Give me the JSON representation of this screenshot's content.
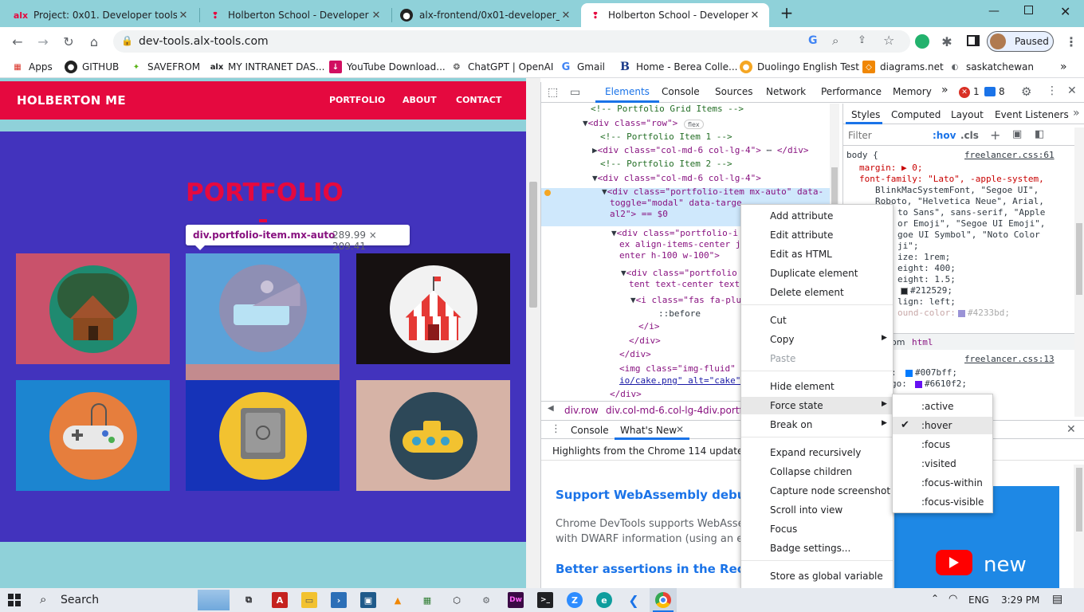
{
  "browser": {
    "tabs": [
      {
        "label": "Project: 0x01. Developer tools | L",
        "icon": "alx-icon"
      },
      {
        "label": "Holberton School - Developer to",
        "icon": "holberton-icon"
      },
      {
        "label": "alx-frontend/0x01-developer_to",
        "icon": "github-icon"
      },
      {
        "label": "Holberton School - Developer to",
        "icon": "holberton-icon"
      }
    ],
    "url": "dev-tools.alx-tools.com",
    "profile_status": "Paused",
    "bookmarks": [
      {
        "label": "Apps"
      },
      {
        "label": "GITHUB"
      },
      {
        "label": "SAVEFROM"
      },
      {
        "label": "MY INTRANET DAS..."
      },
      {
        "label": "YouTube Download..."
      },
      {
        "label": "ChatGPT | OpenAI"
      },
      {
        "label": "Gmail"
      },
      {
        "label": "Home - Berea Colle..."
      },
      {
        "label": "Duolingo English Test"
      },
      {
        "label": "diagrams.net"
      },
      {
        "label": "saskatchewan"
      }
    ]
  },
  "site": {
    "brand": "HOLBERTON ME",
    "nav": [
      "PORTFOLIO",
      "ABOUT",
      "CONTACT"
    ],
    "heading": "PORTFOLIO",
    "tooltip_selector": "div.portfolio-item.mx-auto",
    "tooltip_size": "289.99 × 209.41",
    "tiles": [
      {
        "icon": "cabin-icon",
        "bg": "#c9526b"
      },
      {
        "icon": "cake-icon",
        "bg": "#5ba2d9"
      },
      {
        "icon": "circus-tent-icon",
        "bg": "#161111"
      },
      {
        "icon": "game-controller-icon",
        "bg": "#1c85d0"
      },
      {
        "icon": "safe-icon",
        "bg": "#1533b8"
      },
      {
        "icon": "submarine-icon",
        "bg": "#d6b3a6"
      }
    ]
  },
  "devtools": {
    "tabs": [
      "Elements",
      "Console",
      "Sources",
      "Network",
      "Performance",
      "Memory"
    ],
    "error_count": "1",
    "message_count": "8",
    "dom_lines": [
      "<!-- Portfolio Grid Items -->",
      "<div class=\"row\">",
      "flex",
      "<!-- Portfolio Item 1 -->",
      "<div class=\"col-md-6 col-lg-4\">",
      "</div>",
      "<!-- Portfolio Item 2 -->",
      "<div class=\"col-md-6 col-lg-4\">",
      "<div class=\"portfolio-item mx-auto\" data-",
      "toggle=\"modal\" data-targe",
      "al2\"> == $0",
      "<div class=\"portfolio-i",
      "ex align-items-center j",
      "enter h-100 w-100\">",
      "<div class=\"portfolio",
      "tent text-center text",
      "<i class=\"fas fa-plu",
      "::before",
      "</i>",
      "</div>",
      "</div>",
      "<img class=\"img-fluid\"",
      "io/cake.png\" alt=\"cake\"",
      "</div>"
    ],
    "breadcrumb": [
      "div.row",
      "div.col-md-6.col-lg-4",
      "div.portf"
    ],
    "styles_tabs": [
      "Styles",
      "Computed",
      "Layout",
      "Event Listeners"
    ],
    "filter_placeholder": "Filter",
    "hov": ":hov",
    "cls": ".cls",
    "styles_lines": [
      "body {",
      "freelancer.css:61",
      "margin: ▶ 0;",
      "font-family: \"Lato\", -apple-system,",
      "BlinkMacSystemFont, \"Segoe UI\",",
      "Roboto, \"Helvetica Neue\", Arial,",
      "to Sans\", sans-serif, \"Apple",
      "or Emoji\", \"Segoe UI Emoji\",",
      "goe UI Symbol\", \"Noto Color",
      "ji\";",
      "ize: 1rem;",
      "eight: 400;",
      "eight: 1.5;",
      "#212529;",
      "lign: left;",
      "ound-color: ",
      "#4233bd;",
      "om",
      "html",
      "freelancer.css:13",
      ": ",
      "#007bff;",
      "go: ",
      "#6610f2;"
    ],
    "drawer_tabs": [
      "Console",
      "What's New"
    ],
    "whatsnew_header": "Highlights from the Chrome 114 update",
    "whatsnew_title1": "Support WebAssembly debugg",
    "whatsnew_body1": "Chrome DevTools supports WebAsser",
    "whatsnew_body2": "with DWARF information (using an ext",
    "whatsnew_title2": "Better assertions in the Recorc",
    "video_label": "new"
  },
  "context_menu": {
    "items": [
      "Add attribute",
      "Edit attribute",
      "Edit as HTML",
      "Duplicate element",
      "Delete element",
      "Cut",
      "Copy",
      "Paste",
      "Hide element",
      "Force state",
      "Break on",
      "Expand recursively",
      "Collapse children",
      "Capture node screenshot",
      "Scroll into view",
      "Focus",
      "Badge settings...",
      "Store as global variable"
    ]
  },
  "force_state_menu": {
    "items": [
      ":active",
      ":hover",
      ":focus",
      ":visited",
      ":focus-within",
      ":focus-visible"
    ],
    "checked": ":hover"
  },
  "taskbar": {
    "search": "Search",
    "lang": "ENG",
    "time": "3:29 PM"
  },
  "colors": {
    "brand_red": "#e5093f",
    "page_bg": "#4233bd",
    "teal": "#8fd1d9",
    "link_blue": "#1a73e8"
  }
}
